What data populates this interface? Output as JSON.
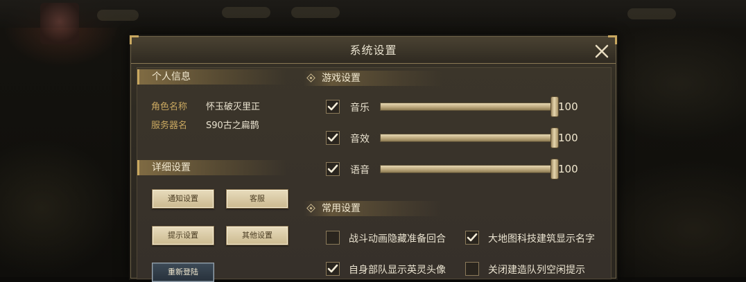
{
  "dialog": {
    "title": "系统设置",
    "close_icon": "close-icon"
  },
  "personal_info": {
    "header": "个人信息",
    "role_label": "角色名称",
    "role_value": "怀玉破灭里正",
    "server_label": "服务器名",
    "server_value": "S90古之扁鹊"
  },
  "detail_settings": {
    "header": "详细设置",
    "buttons": {
      "notify": "通知设置",
      "service": "客服",
      "hint": "提示设置",
      "other": "其他设置",
      "relogin": "重新登陆"
    }
  },
  "game_settings": {
    "header": "游戏设置",
    "sliders": [
      {
        "label": "音乐",
        "value": 100,
        "display": "100",
        "checked": true
      },
      {
        "label": "音效",
        "value": 100,
        "display": "100",
        "checked": true
      },
      {
        "label": "语音",
        "value": 100,
        "display": "100",
        "checked": true
      }
    ]
  },
  "common_settings": {
    "header": "常用设置",
    "options": [
      {
        "label": "战斗动画隐藏准备回合",
        "checked": false
      },
      {
        "label": "大地图科技建筑显示名字",
        "checked": true
      },
      {
        "label": "自身部队显示英灵头像",
        "checked": true
      },
      {
        "label": "关闭建造队列空闲提示",
        "checked": false
      }
    ]
  },
  "colors": {
    "accent_gold": "#c9a860",
    "panel_bg": "#36302a",
    "text_light": "#eae3d0"
  }
}
